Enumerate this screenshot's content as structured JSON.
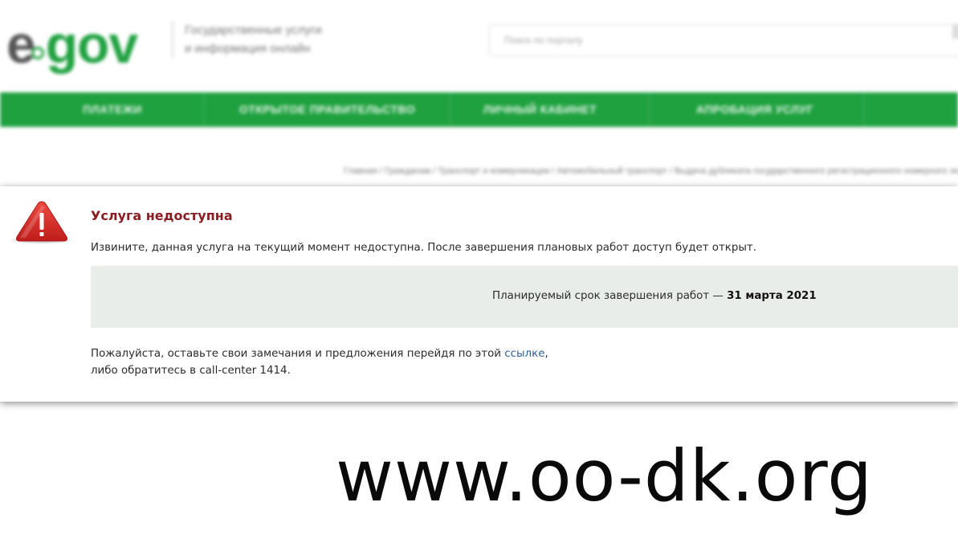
{
  "header": {
    "logo_left": "e",
    "logo_right": "gov",
    "tagline_line1": "Государственные услуги",
    "tagline_line2": "и информация онлайн",
    "search_placeholder": "Поиск по порталу"
  },
  "nav": {
    "items": [
      {
        "label": "Платежи"
      },
      {
        "label": "Открытое правительство"
      },
      {
        "label": "Личный кабинет"
      },
      {
        "label": "Апробация услуг"
      }
    ]
  },
  "breadcrumb": "Главная / Гражданам / Транспорт и коммуникации / Автомобильный транспорт / Выдача дубликата государственного регистрационного номерного знака",
  "modal": {
    "title": "Услуга недоступна",
    "message": "Извините, данная услуга на текущий момент недоступна. После завершения плановых работ доступ будет открыт.",
    "deadline_prefix": "Планируемый срок завершения работ — ",
    "deadline_date": "31 марта 2021",
    "feedback_prefix": "Пожалуйста, оставьте свои замечания и предложения перейдя по этой ",
    "feedback_link": "ссылке",
    "feedback_suffix": ",",
    "feedback_line2": "либо обратитесь в call-center 1414."
  },
  "watermark": "www.oo-dk.org",
  "colors": {
    "brand_green": "#1fa140",
    "title_red": "#8a1f23",
    "warning_red": "#d42a25",
    "link_blue": "#2f5f9a",
    "info_bg": "#e9edea"
  }
}
